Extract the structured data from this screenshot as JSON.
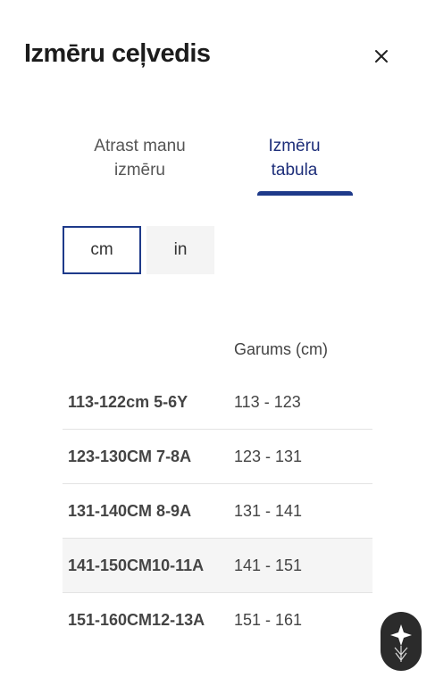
{
  "header": {
    "title": "Izmēru ceļvedis",
    "close_icon": "close-icon"
  },
  "tabs": [
    {
      "label": "Atrast manu\nizmēru",
      "active": false
    },
    {
      "label": "Izmēru\ntabula",
      "active": true
    }
  ],
  "units": {
    "cm": "cm",
    "in": "in",
    "selected": "cm"
  },
  "table": {
    "headers": [
      "",
      "Garums (cm)"
    ],
    "rows": [
      {
        "size": "113-122cm 5-6Y",
        "length": "113 - 123"
      },
      {
        "size": "123-130CM 7-8A",
        "length": "123 - 131"
      },
      {
        "size": "131-140CM 8-9A",
        "length": "131 - 141"
      },
      {
        "size": "141-150CM10-11A",
        "length": "141 - 151"
      },
      {
        "size": "151-160CM12-13A",
        "length": "151 - 161"
      }
    ]
  },
  "assistant": {
    "icon": "assistant-logo-icon"
  },
  "colors": {
    "accent": "#1e3a8a",
    "row_shade": "#f5f5f5",
    "fab_bg": "#2b2b2b"
  }
}
